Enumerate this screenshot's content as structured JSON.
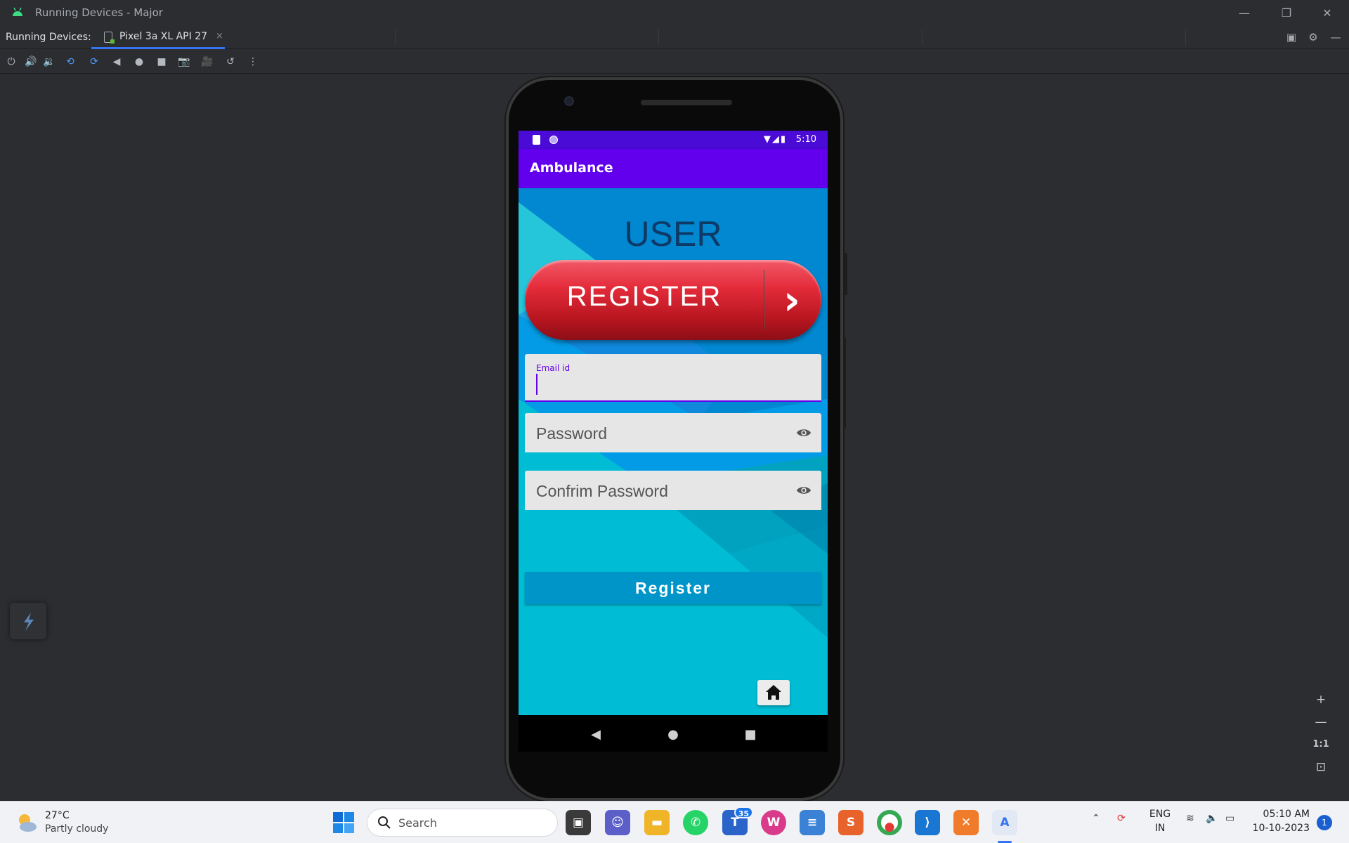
{
  "window": {
    "title": "Running Devices - Major",
    "minimize": "—",
    "restore": "❐",
    "close": "✕"
  },
  "tabbar": {
    "label": "Running Devices:",
    "tab_label": "Pixel 3a XL API 27",
    "tab_close": "×"
  },
  "toolbar": {
    "icons": [
      "power-icon",
      "volume-up-icon",
      "volume-down-icon",
      "rotate-left-icon",
      "rotate-right-icon",
      "back-icon",
      "home-icon",
      "overview-icon",
      "screenshot-icon",
      "screen-record-icon",
      "reset-icon",
      "more-icon"
    ]
  },
  "device": {
    "status_time": "5:10",
    "app_title": "Ambulance",
    "banner_title": "REGISTER",
    "heading": "USER",
    "email_label": "Email id",
    "password_placeholder": "Password",
    "confirm_placeholder": "Confrim Password",
    "submit_label": "Register"
  },
  "zoom": {
    "zoom_in": "+",
    "zoom_out": "—",
    "actual_size": "1:1"
  },
  "taskbar": {
    "temperature": "27°C",
    "condition": "Partly cloudy",
    "search_placeholder": "Search",
    "teams_badge": "35",
    "lang_line1": "ENG",
    "lang_line2": "IN",
    "time": "05:10 AM",
    "date": "10-10-2023",
    "notification_count": "1"
  },
  "colors": {
    "app_bar": "#6200ee",
    "status_bar": "#4a0bd6",
    "register_button": "#0095c8",
    "banner_red": "#e42b3a",
    "accent_blue": "#3574f0"
  }
}
